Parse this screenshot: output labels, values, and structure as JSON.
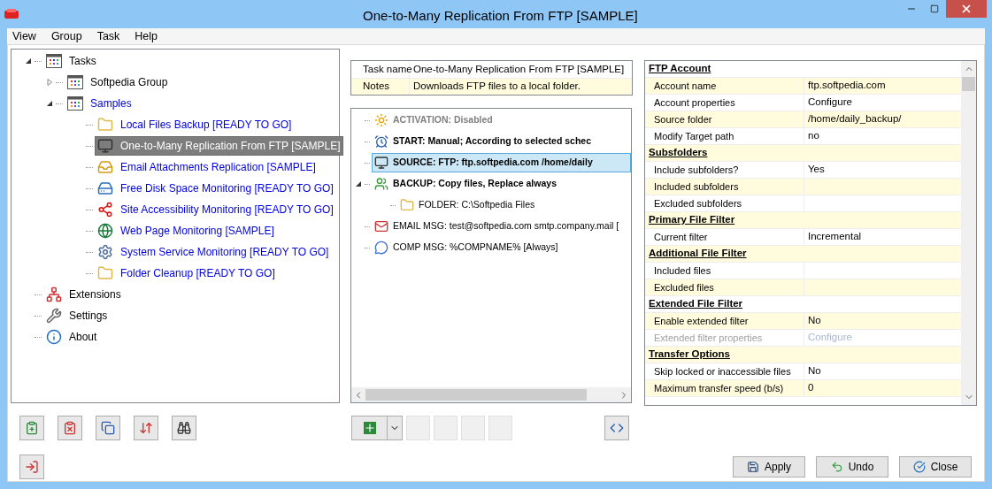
{
  "window": {
    "title": "One-to-Many Replication From FTP [SAMPLE]"
  },
  "menu": [
    "View",
    "Group",
    "Task",
    "Help"
  ],
  "task_tree": [
    {
      "label": "Tasks",
      "expanded": true,
      "is_sample": false,
      "selected": false,
      "children": [
        {
          "label": "Softpedia Group",
          "expanded": false,
          "is_sample": false,
          "selected": false
        },
        {
          "label": "Samples",
          "expanded": true,
          "is_sample": true,
          "selected": false,
          "children": [
            {
              "label": "Local Files Backup [READY TO GO]",
              "is_sample": true,
              "selected": false
            },
            {
              "label": "One-to-Many Replication From FTP [SAMPLE]",
              "selected": true
            },
            {
              "label": "Email Attachments Replication [SAMPLE]",
              "is_sample": true,
              "selected": false
            },
            {
              "label": "Free Disk Space Monitoring [READY TO GO]",
              "is_sample": true,
              "selected": false
            },
            {
              "label": "Site Accessibility Monitoring [READY TO GO]",
              "is_sample": true,
              "selected": false
            },
            {
              "label": "Web Page Monitoring [SAMPLE]",
              "is_sample": true,
              "selected": false
            },
            {
              "label": "System Service Monitoring [READY TO GO]",
              "is_sample": true,
              "selected": false
            },
            {
              "label": "Folder Cleanup [READY TO GO]",
              "is_sample": true,
              "selected": false
            }
          ]
        }
      ]
    },
    {
      "label": "Extensions",
      "is_sample": false,
      "selected": false
    },
    {
      "label": "Settings",
      "is_sample": false,
      "selected": false
    },
    {
      "label": "About",
      "is_sample": false,
      "selected": false
    }
  ],
  "task_info": [
    {
      "label": "Task name",
      "value": "One-to-Many Replication From FTP [SAMPLE]"
    },
    {
      "label": "Notes",
      "value": "Downloads FTP files to a local folder."
    }
  ],
  "steps": [
    {
      "label": "ACTIVATION: Disabled",
      "kind": "main",
      "disabled": true,
      "selected": false
    },
    {
      "label": "START: Manual; According to selected schec",
      "kind": "main",
      "disabled": false,
      "selected": false
    },
    {
      "label": "SOURCE: FTP: ftp.softpedia.com /home/daily",
      "kind": "main",
      "disabled": false,
      "selected": true
    },
    {
      "label": "BACKUP: Copy files, Replace always",
      "kind": "main",
      "disabled": false,
      "selected": false,
      "expanded": true,
      "children": [
        {
          "label": "FOLDER: C:\\Softpedia Files",
          "kind": "detail",
          "disabled": false,
          "selected": false
        }
      ]
    },
    {
      "label": "EMAIL MSG: test@softpedia.com smtp.company.mail [",
      "kind": "detail",
      "disabled": false,
      "selected": false
    },
    {
      "label": "COMP MSG: %COMPNAME% [Always]",
      "kind": "detail",
      "disabled": false,
      "selected": false
    }
  ],
  "properties": [
    {
      "title": "FTP Account",
      "rows": [
        {
          "name": "Account name",
          "value": "ftp.softpedia.com",
          "disabled": false
        },
        {
          "name": "Account properties",
          "value": "Configure",
          "disabled": false
        },
        {
          "name": "Source folder",
          "value": "/home/daily_backup/",
          "disabled": false
        },
        {
          "name": "Modify Target path",
          "value": "no",
          "disabled": false
        }
      ]
    },
    {
      "title": "Subsfolders",
      "rows": [
        {
          "name": "Include subfolders?",
          "value": "Yes",
          "disabled": false
        },
        {
          "name": "Included subfolders",
          "disabled": false
        },
        {
          "name": "Excluded subfolders",
          "disabled": false
        }
      ]
    },
    {
      "title": "Primary File Filter",
      "rows": [
        {
          "name": "Current filter",
          "value": "Incremental",
          "disabled": false
        }
      ]
    },
    {
      "title": "Additional File Filter",
      "rows": [
        {
          "name": "Included files",
          "disabled": false
        },
        {
          "name": "Excluded files",
          "disabled": false
        }
      ]
    },
    {
      "title": "Extended File Filter",
      "rows": [
        {
          "name": "Enable extended filter",
          "value": "No",
          "disabled": false
        },
        {
          "name": "Extended filter properties",
          "value": "Configure",
          "disabled": true
        }
      ]
    },
    {
      "title": "Transfer Options",
      "rows": [
        {
          "name": "Skip locked or inaccessible files",
          "value": "No",
          "disabled": false
        },
        {
          "name": "Maximum transfer speed (b/s)",
          "value": "0",
          "disabled": false
        }
      ]
    }
  ],
  "footer_buttons": [
    "Apply",
    "Undo",
    "Close"
  ]
}
